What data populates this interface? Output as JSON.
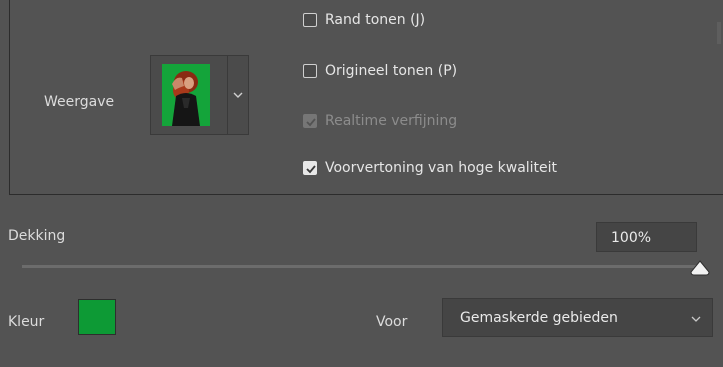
{
  "weergave": {
    "label": "Weergave"
  },
  "options": [
    {
      "label": "Rand tonen (J)",
      "checked": false,
      "disabled": false
    },
    {
      "label": "Origineel tonen (P)",
      "checked": false,
      "disabled": false
    },
    {
      "label": "Realtime verfijning",
      "checked": true,
      "disabled": true
    },
    {
      "label": "Voorvertoning van hoge kwaliteit",
      "checked": true,
      "disabled": false
    }
  ],
  "dekking": {
    "label": "Dekking",
    "value": "100%",
    "slider_fraction": 1.0
  },
  "kleur": {
    "label": "Kleur",
    "color": "#0d9a35"
  },
  "voor": {
    "label": "Voor",
    "selected": "Gemaskerde gebieden"
  },
  "colors": {
    "background": "#535353",
    "accent_green": "#14a43a"
  }
}
